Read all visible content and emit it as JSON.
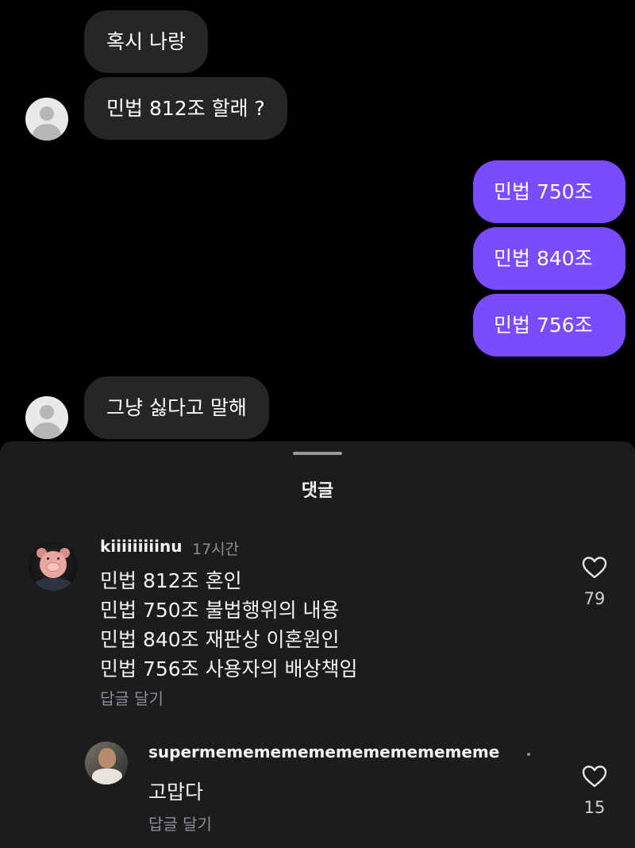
{
  "chat": {
    "incoming_1": "혹시 나랑",
    "incoming_2": "민법 812조 할래 ?",
    "outgoing_1": "민법 750조",
    "outgoing_2": "민법 840조",
    "outgoing_3": "민법 756조",
    "incoming_3": "그냥 싫다고 말해"
  },
  "sheet": {
    "title": "댓글"
  },
  "comments": [
    {
      "username": "kiiiiiiiiinu",
      "time": "17시간",
      "lines": [
        "민법 812조 혼인",
        "민법 750조 불법행위의 내용",
        "민법 840조 재판상 이혼원인",
        "민법 756조 사용자의 배상책임"
      ],
      "reply_label": "답글 달기",
      "like_count": "79",
      "avatar_icon": "pig-avatar"
    },
    {
      "username": "supermememememememememememe",
      "lines": [
        "고맙다"
      ],
      "reply_label": "답글 달기",
      "like_count": "15",
      "avatar_icon": "profile-photo-avatar"
    }
  ],
  "colors": {
    "background": "#000000",
    "sheet_background": "#1c1c1f",
    "incoming_bubble": "#262626",
    "outgoing_bubble": "#7b4cff",
    "muted_text": "#8e8e93"
  },
  "icons": {
    "like": "heart-outline-icon",
    "avatar_default": "default-avatar-icon"
  }
}
